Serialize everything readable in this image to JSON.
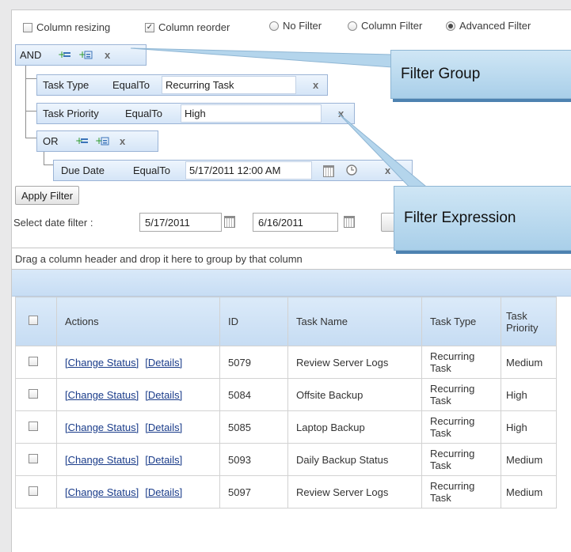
{
  "options": {
    "column_resizing": {
      "label": "Column resizing",
      "checked": false
    },
    "column_reorder": {
      "label": "Column reorder",
      "checked": true
    },
    "filter_modes": [
      {
        "label": "No Filter",
        "selected": false
      },
      {
        "label": "Column Filter",
        "selected": false
      },
      {
        "label": "Advanced Filter",
        "selected": true
      }
    ]
  },
  "filter": {
    "root_operator": "AND",
    "expressions": [
      {
        "field": "Task Type",
        "op": "EqualTo",
        "value": "Recurring Task"
      },
      {
        "field": "Task Priority",
        "op": "EqualTo",
        "value": "High"
      }
    ],
    "sub_group": {
      "operator": "OR",
      "expressions": [
        {
          "field": "Due Date",
          "op": "EqualTo",
          "value": "5/17/2011 12:00 AM"
        }
      ]
    },
    "remove_glyph": "x",
    "apply_label": "Apply Filter"
  },
  "date_filter": {
    "label": "Select date filter :",
    "from": "5/17/2011",
    "to": "6/16/2011"
  },
  "callouts": {
    "filter_group": "Filter Group",
    "filter_expression": "Filter Expression"
  },
  "grid": {
    "group_panel_text": "Drag a column header and drop it here to group by that column",
    "columns": [
      "Actions",
      "ID",
      "Task Name",
      "Task Type",
      "Task Priority"
    ],
    "action_links": [
      "[Change Status]",
      "[Details]"
    ],
    "rows": [
      {
        "id": "5079",
        "name": "Review Server Logs",
        "type": "Recurring Task",
        "priority": "Medium"
      },
      {
        "id": "5084",
        "name": "Offsite Backup",
        "type": "Recurring Task",
        "priority": "High"
      },
      {
        "id": "5085",
        "name": "Laptop Backup",
        "type": "Recurring Task",
        "priority": "High"
      },
      {
        "id": "5093",
        "name": "Daily Backup Status",
        "type": "Recurring Task",
        "priority": "Medium"
      },
      {
        "id": "5097",
        "name": "Review Server Logs",
        "type": "Recurring Task",
        "priority": "Medium"
      }
    ]
  },
  "colors": {
    "accent_blue": "#c7ddf4",
    "callout": "#a9cfe9",
    "link": "#1a3c8a"
  }
}
